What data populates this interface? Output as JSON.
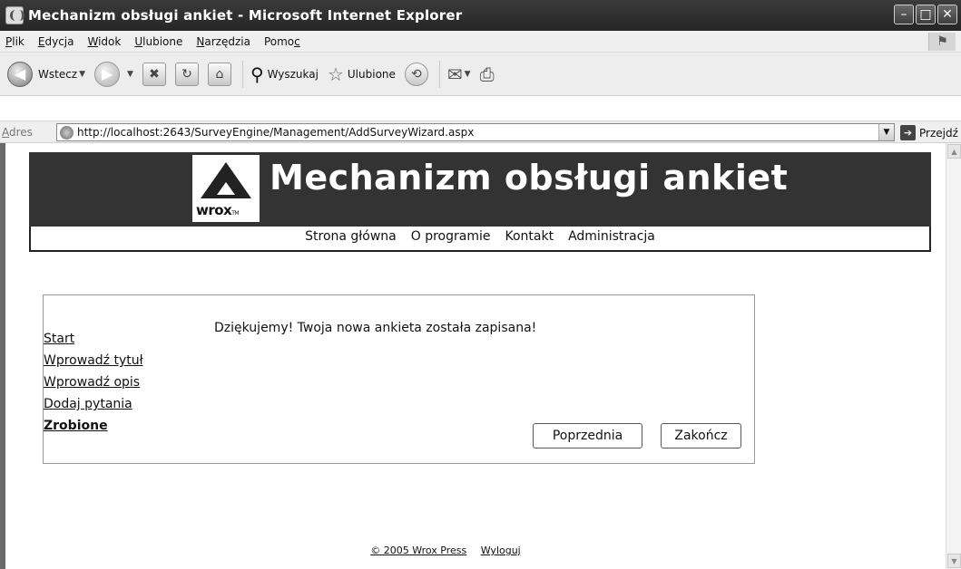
{
  "window": {
    "title": "Mechanizm obsługi ankiet - Microsoft Internet Explorer",
    "buttons": {
      "minimize": "–",
      "maximize": "□",
      "close": "✕"
    }
  },
  "menu": [
    {
      "prefix": "",
      "underlined": "P",
      "rest": "lik"
    },
    {
      "prefix": "",
      "underlined": "E",
      "rest": "dycja"
    },
    {
      "prefix": "",
      "underlined": "W",
      "rest": "idok"
    },
    {
      "prefix": "",
      "underlined": "U",
      "rest": "lubione"
    },
    {
      "prefix": "",
      "underlined": "N",
      "rest": "arzędzia"
    },
    {
      "prefix": "Pomo",
      "underlined": "c",
      "rest": ""
    }
  ],
  "toolbar": {
    "back": "Wstecz",
    "search": "Wyszukaj",
    "favorites": "Ulubione"
  },
  "address": {
    "label_underlined": "A",
    "label_rest": "dres",
    "url": "http://localhost:2643/SurveyEngine/Management/AddSurveyWizard.aspx",
    "go": "Przejdź"
  },
  "site": {
    "logo": "wrox",
    "logo_tm": "TM",
    "title": "Mechanizm obsługi ankiet",
    "nav": [
      "Strona główna",
      "O programie",
      "Kontakt",
      "Administracja"
    ]
  },
  "wizard": {
    "steps": [
      "Start",
      "Wprowadź tytuł",
      "Wprowadź opis",
      "Dodaj pytania",
      "Zrobione"
    ],
    "active_step": 4,
    "message": "Dziękujemy! Twoja nowa ankieta została zapisana!",
    "prev_button": "Poprzednia",
    "finish_button": "Zakończ"
  },
  "footer": {
    "copyright": "© 2005 Wrox Press",
    "logout": "Wyloguj"
  }
}
